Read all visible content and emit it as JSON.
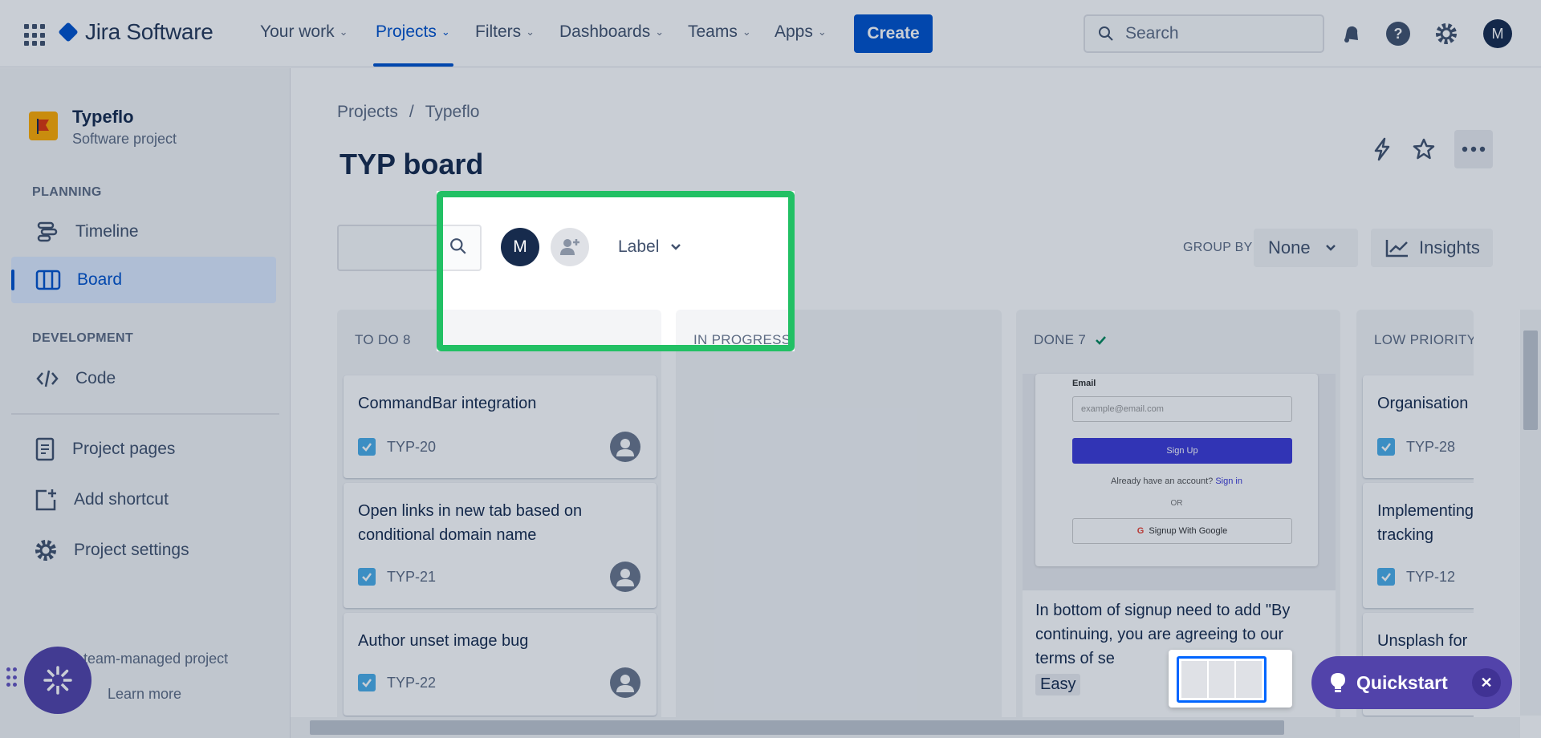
{
  "topnav": {
    "product_name": "Jira Software",
    "items": [
      {
        "label": "Your work"
      },
      {
        "label": "Projects"
      },
      {
        "label": "Filters"
      },
      {
        "label": "Dashboards"
      },
      {
        "label": "Teams"
      },
      {
        "label": "Apps"
      }
    ],
    "create_label": "Create",
    "search_placeholder": "Search",
    "avatar_initial": "M"
  },
  "sidebar": {
    "project_name": "Typeflo",
    "project_type": "Software project",
    "planning_label": "PLANNING",
    "timeline_label": "Timeline",
    "board_label": "Board",
    "development_label": "DEVELOPMENT",
    "code_label": "Code",
    "project_pages_label": "Project pages",
    "add_shortcut_label": "Add shortcut",
    "project_settings_label": "Project settings",
    "footer_text": "n a team-managed project",
    "learn_more": "Learn more"
  },
  "main": {
    "breadcrumb": {
      "projects": "Projects",
      "separator": "/",
      "project": "Typeflo"
    },
    "title": "TYP board",
    "avatar_filter_initial": "M",
    "label_filter": "Label",
    "group_by_label": "GROUP BY",
    "group_by_value": "None",
    "insights_label": "Insights"
  },
  "columns": {
    "todo": {
      "title": "TO DO 8",
      "cards": [
        {
          "title": "CommandBar integration",
          "key": "TYP-20"
        },
        {
          "title": "Open links in new tab based on conditional domain name",
          "key": "TYP-21"
        },
        {
          "title": "Author unset image bug",
          "key": "TYP-22"
        }
      ]
    },
    "in_progress": {
      "title": "IN PROGRESS"
    },
    "done": {
      "title": "DONE 7",
      "preview": {
        "email_label": "Email",
        "email_placeholder": "example@email.com",
        "signup_button": "Sign Up",
        "have_account": "Already have an account?",
        "sign_in": "Sign in",
        "or": "OR",
        "google_button": "Signup With Google"
      },
      "card_text": "In bottom of signup need to add \"By continuing, you are agreeing to our terms of se",
      "card_tag": "Easy"
    },
    "low_priority": {
      "title": "LOW PRIORITY",
      "cards": [
        {
          "title": "Organisation",
          "key": "TYP-28"
        },
        {
          "title": "Implementing tracking",
          "key": "TYP-12"
        },
        {
          "title": "Unsplash for"
        }
      ]
    }
  },
  "quickstart": {
    "label": "Quickstart"
  },
  "colors": {
    "accent": "#0052cc",
    "highlight": "#22c064",
    "purple": "#5243aa"
  }
}
